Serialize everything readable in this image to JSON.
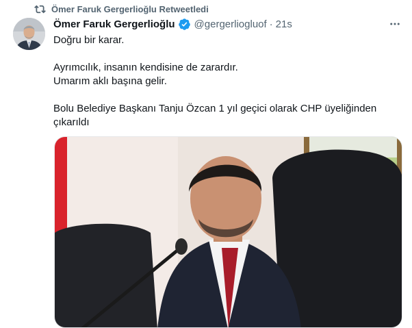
{
  "retweet": {
    "label": "Ömer Faruk Gergerlioğlu Retweetledi",
    "icon": "retweet-icon"
  },
  "tweet": {
    "author_name": "Ömer Faruk Gergerlioğlu",
    "handle": "@gergerliogluof",
    "separator": "·",
    "time": "21s",
    "verified": true,
    "lines": [
      "Doğru bir karar.",
      "",
      "Ayrımcılık, insanın kendisine de zarardır.",
      "Umarım aklı başına gelir.",
      "",
      "Bolu Belediye Başkanı Tanju Özcan 1 yıl geçici olarak CHP üyeliğinden",
      "çıkarıldı"
    ]
  },
  "colors": {
    "text_primary": "#0f1419",
    "text_secondary": "#536471",
    "verified_blue": "#1d9bf0",
    "background": "#ffffff"
  }
}
